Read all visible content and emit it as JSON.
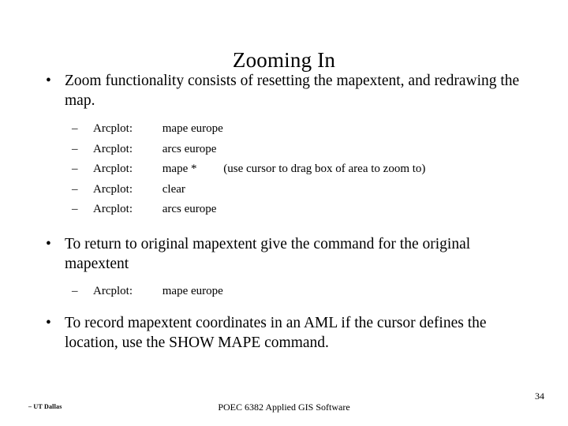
{
  "slide": {
    "title": "Zooming In",
    "background_color": "#ffffff",
    "text_color": "#000000",
    "bullet_glyph": "•",
    "dash_glyph": "–"
  },
  "body": {
    "bullet1": {
      "text": "Zoom functionality consists of resetting the mapextent, and redrawing the map."
    },
    "commands1": [
      {
        "label": "Arcplot:",
        "command": "mape europe",
        "note": ""
      },
      {
        "label": "Arcplot:",
        "command": "arcs europe",
        "note": ""
      },
      {
        "label": "Arcplot:",
        "command": "mape *",
        "note": "(use cursor to drag box of area to zoom to)"
      },
      {
        "label": "Arcplot:",
        "command": "clear",
        "note": ""
      },
      {
        "label": "Arcplot:",
        "command": "arcs europe",
        "note": ""
      }
    ],
    "bullet2": {
      "text": "To return to original mapextent give the command for the original mapextent"
    },
    "commands2": [
      {
        "label": "Arcplot:",
        "command": "mape europe",
        "note": ""
      }
    ],
    "bullet3": {
      "text": "To record mapextent coordinates in an AML if the cursor defines the location, use the SHOW MAPE command."
    }
  },
  "footer": {
    "left": "– UT Dallas",
    "center": "POEC 6382 Applied GIS Software",
    "page_number": "34"
  }
}
